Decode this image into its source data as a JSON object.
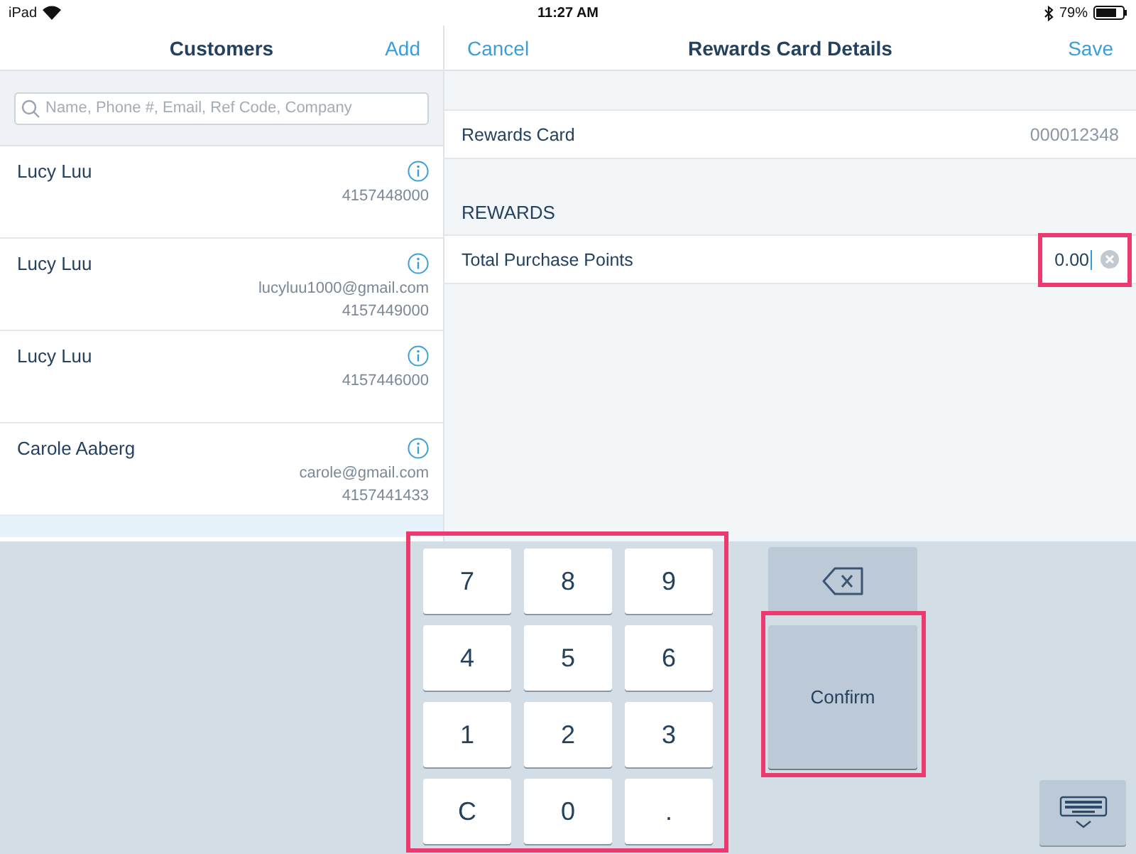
{
  "status_bar": {
    "carrier": "iPad",
    "time": "11:27 AM",
    "battery": "79%"
  },
  "customers": {
    "title": "Customers",
    "add": "Add",
    "search": {
      "placeholder": "Name, Phone #, Email, Ref Code, Company"
    },
    "rows": [
      {
        "name": "Lucy Luu",
        "lines": [
          "4157448000"
        ],
        "selected": false
      },
      {
        "name": "Lucy Luu",
        "lines": [
          "lucyluu1000@gmail.com",
          "4157449000"
        ],
        "selected": false
      },
      {
        "name": "Lucy Luu",
        "lines": [
          "4157446000"
        ],
        "selected": false
      },
      {
        "name": "Carole Aaberg",
        "lines": [
          "carole@gmail.com",
          "4157441433"
        ],
        "selected": false
      },
      {
        "lines": [],
        "selected": true
      }
    ]
  },
  "details": {
    "cancel": "Cancel",
    "title": "Rewards Card Details",
    "save": "Save",
    "card_label": "Rewards Card",
    "card_number": "000012348",
    "section": "REWARDS",
    "points_label": "Total Purchase Points",
    "points_value": "0.00"
  },
  "keypad": {
    "keys": [
      "7",
      "8",
      "9",
      "4",
      "5",
      "6",
      "1",
      "2",
      "3",
      "C",
      "0",
      "."
    ],
    "confirm": "Confirm"
  }
}
